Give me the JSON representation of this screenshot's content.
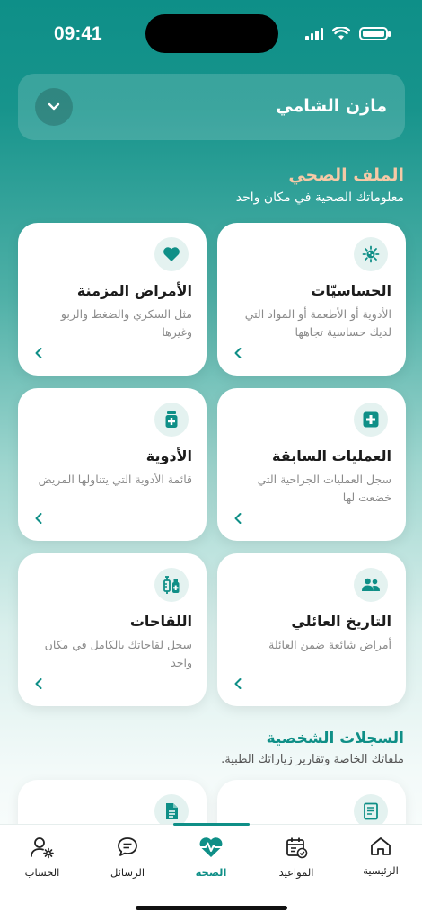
{
  "status": {
    "time": "09:41"
  },
  "profile": {
    "name": "مازن الشامي"
  },
  "health_file": {
    "title": "الملف الصحي",
    "subtitle": "معلوماتك الصحية في مكان واحد",
    "cards": [
      {
        "title": "الحساسيّات",
        "desc": "الأدوية أو الأطعمة أو المواد التي لديك حساسية تجاهها",
        "icon": "allergy-icon"
      },
      {
        "title": "الأمراض المزمنة",
        "desc": "مثل السكري والضغط والربو وغيرها",
        "icon": "heart-icon"
      },
      {
        "title": "العمليات السابقة",
        "desc": "سجل العمليات الجراحية التي خضعت لها",
        "icon": "medical-plus-icon"
      },
      {
        "title": "الأدوية",
        "desc": "قائمة الأدوية التي يتناولها المريض",
        "icon": "medicine-bottle-icon"
      },
      {
        "title": "التاريخ العائلي",
        "desc": "أمراض شائعة ضمن العائلة",
        "icon": "family-icon"
      },
      {
        "title": "اللقاحات",
        "desc": "سجل لقاحاتك بالكامل في مكان واحد",
        "icon": "vaccine-icon"
      }
    ]
  },
  "records": {
    "title": "السجلات الشخصية",
    "subtitle": "ملفاتك الخاصة وتقارير زياراتك الطبية."
  },
  "nav": {
    "home": "الرئيسية",
    "appointments": "المواعيد",
    "health": "الصحة",
    "messages": "الرسائل",
    "account": "الحساب",
    "active": "health"
  },
  "colors": {
    "primary": "#0f8f87",
    "title_accent": "#f6c9a6"
  }
}
